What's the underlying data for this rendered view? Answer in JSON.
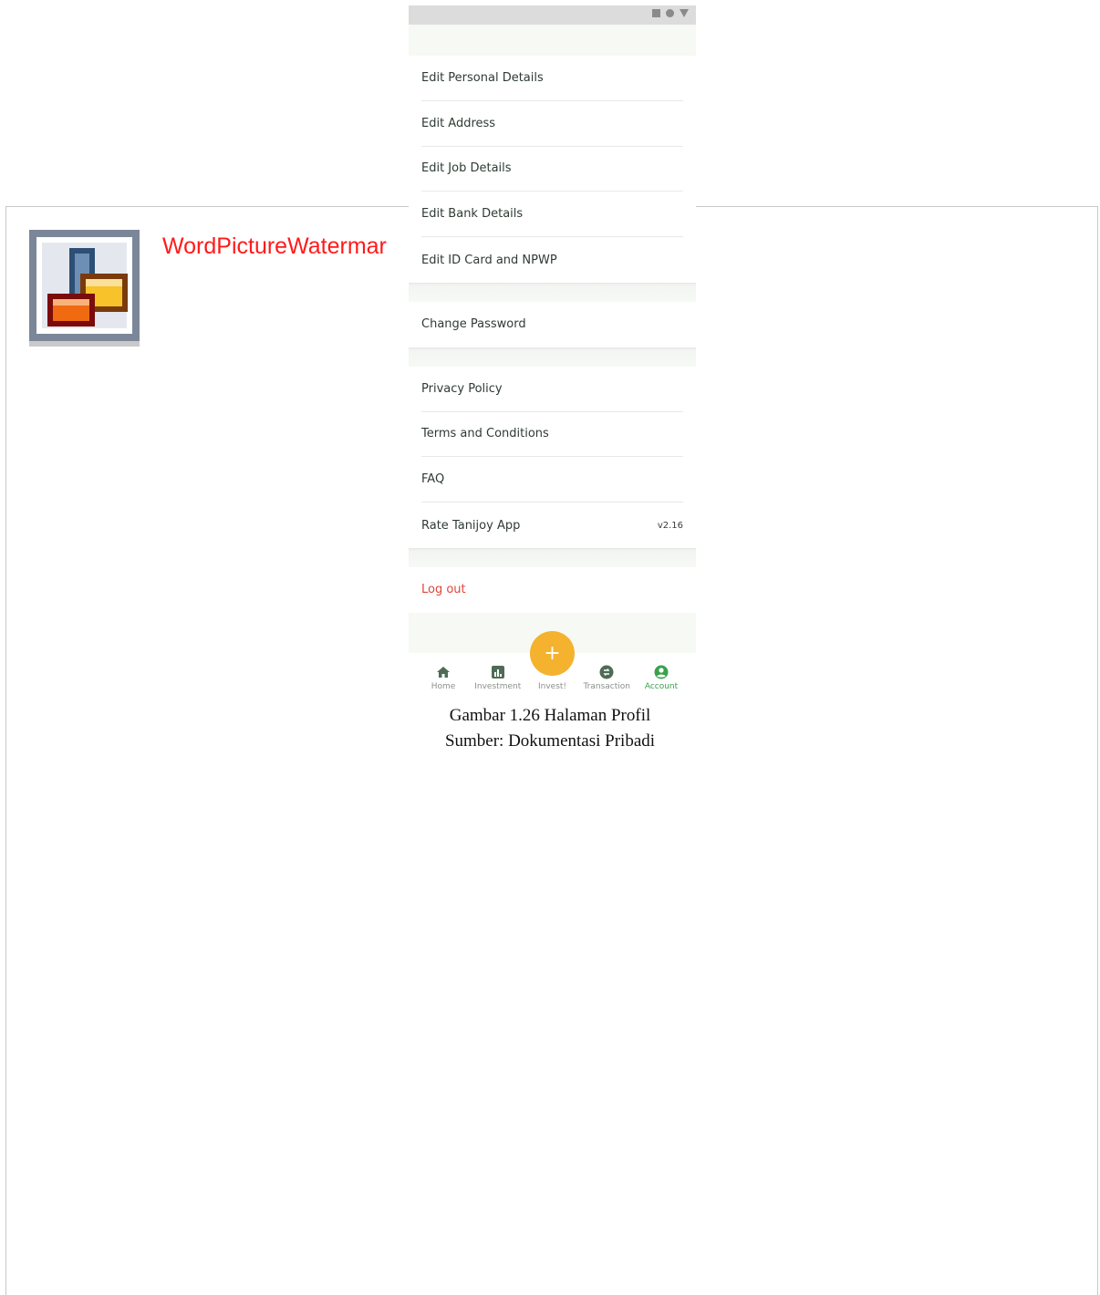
{
  "watermark": {
    "label": "WordPictureWatermar"
  },
  "phone": {
    "status_icons": [
      "square-icon",
      "circle-icon",
      "triangle-icon"
    ],
    "groups": [
      {
        "items": [
          {
            "label": "Edit Personal Details"
          },
          {
            "label": "Edit Address"
          },
          {
            "label": "Edit Job Details"
          },
          {
            "label": "Edit Bank Details"
          },
          {
            "label": "Edit ID Card and NPWP"
          }
        ]
      },
      {
        "items": [
          {
            "label": "Change Password"
          }
        ]
      },
      {
        "items": [
          {
            "label": "Privacy Policy"
          },
          {
            "label": "Terms and Conditions"
          },
          {
            "label": "FAQ"
          },
          {
            "label": "Rate Tanijoy App",
            "version": "v2.16"
          }
        ]
      },
      {
        "items": [
          {
            "label": "Log out"
          }
        ]
      }
    ],
    "nav": {
      "items": [
        {
          "label": "Home",
          "icon": "home-icon"
        },
        {
          "label": "Investment",
          "icon": "chart-icon"
        },
        {
          "label": "Invest!",
          "icon": "plus-icon"
        },
        {
          "label": "Transaction",
          "icon": "transfer-icon"
        },
        {
          "label": "Account",
          "icon": "account-icon",
          "active": true
        }
      ],
      "fab_symbol": "+"
    },
    "colors": {
      "accent_green": "#3aa14b",
      "fab_yellow": "#f4b22e",
      "logout_red": "#e0453a"
    }
  },
  "caption": {
    "line1": "Gambar 1.26 Halaman Profil",
    "line2": "Sumber: Dokumentasi Pribadi"
  }
}
